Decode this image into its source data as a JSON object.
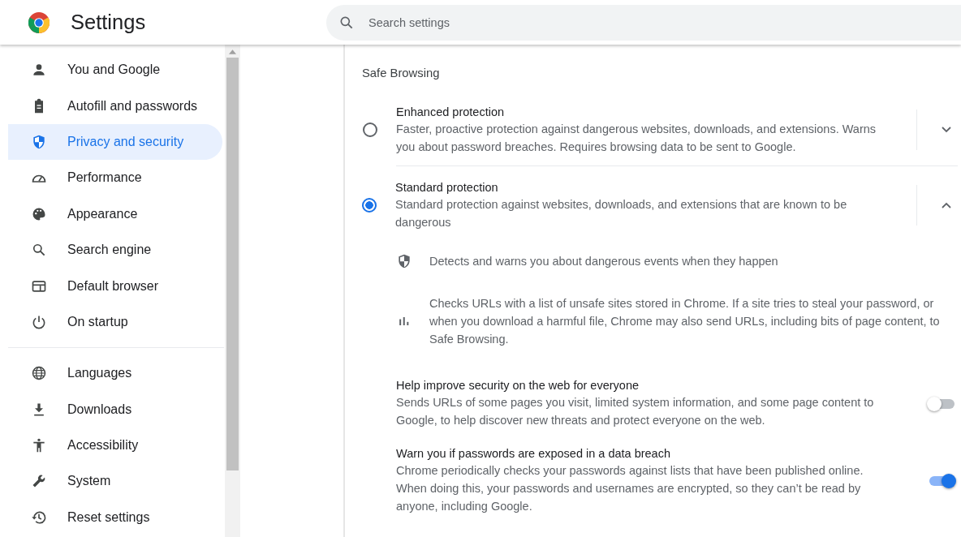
{
  "header": {
    "title": "Settings",
    "search": {
      "placeholder": "Search settings"
    }
  },
  "sidebar": {
    "groups": [
      {
        "items": [
          {
            "label": "You and Google",
            "selected": false
          },
          {
            "label": "Autofill and passwords",
            "selected": false
          },
          {
            "label": "Privacy and security",
            "selected": true
          },
          {
            "label": "Performance",
            "selected": false
          },
          {
            "label": "Appearance",
            "selected": false
          },
          {
            "label": "Search engine",
            "selected": false
          },
          {
            "label": "Default browser",
            "selected": false
          },
          {
            "label": "On startup",
            "selected": false
          }
        ]
      },
      {
        "items": [
          {
            "label": "Languages",
            "selected": false
          },
          {
            "label": "Downloads",
            "selected": false
          },
          {
            "label": "Accessibility",
            "selected": false
          },
          {
            "label": "System",
            "selected": false
          },
          {
            "label": "Reset settings",
            "selected": false
          }
        ]
      }
    ]
  },
  "safe_browsing": {
    "heading": "Safe Browsing",
    "options": [
      {
        "title": "Enhanced protection",
        "description": "Faster, proactive protection against dangerous websites, downloads, and extensions. Warns you about password breaches. Requires browsing data to be sent to Google.",
        "selected": false,
        "expanded": false
      },
      {
        "title": "Standard protection",
        "description": "Standard protection against websites, downloads, and extensions that are known to be dangerous",
        "selected": true,
        "expanded": true,
        "details": [
          {
            "text": "Detects and warns you about dangerous events when they happen"
          },
          {
            "text": "Checks URLs with a list of unsafe sites stored in Chrome. If a site tries to steal your password, or when you download a harmful file, Chrome may also send URLs, including bits of page content, to Safe Browsing."
          }
        ]
      }
    ],
    "toggles": [
      {
        "title": "Help improve security on the web for everyone",
        "description": "Sends URLs of some pages you visit, limited system information, and some page content to Google, to help discover new threats and protect everyone on the web.",
        "on": false
      },
      {
        "title": "Warn you if passwords are exposed in a data breach",
        "description": "Chrome periodically checks your passwords against lists that have been published online. When doing this, your passwords and usernames are encrypted, so they can’t be read by anyone, including Google.",
        "on": true
      }
    ]
  }
}
